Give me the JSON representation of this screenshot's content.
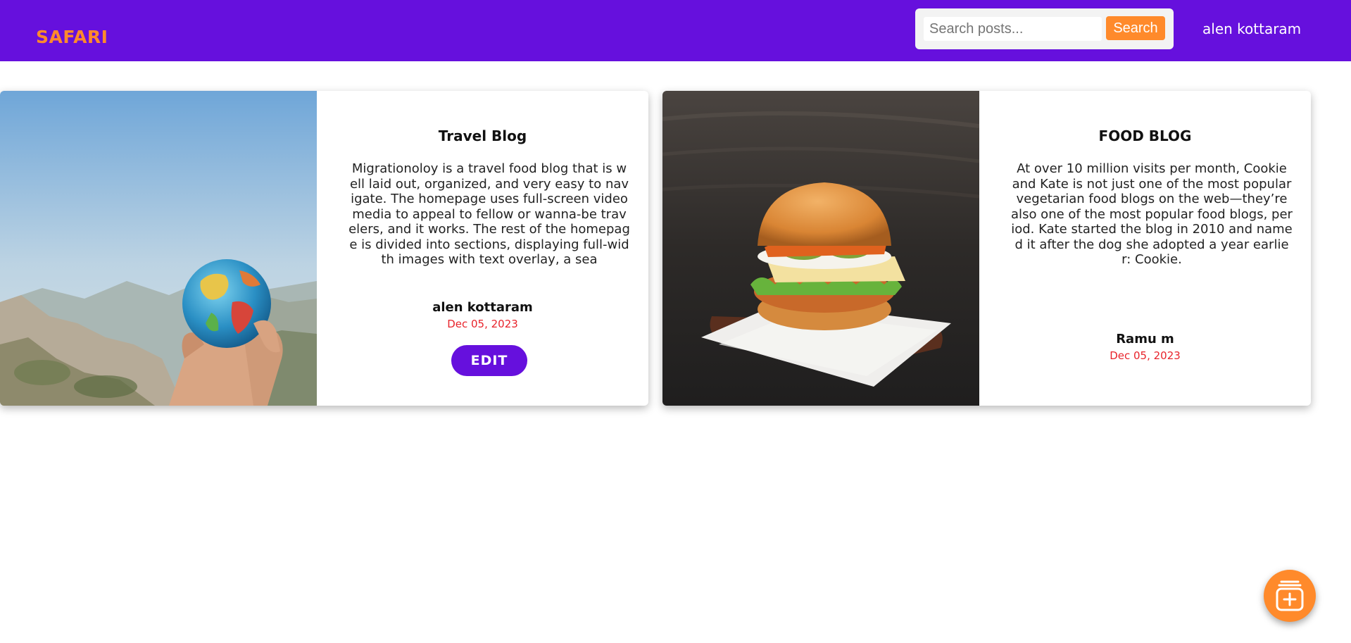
{
  "navbar": {
    "brand": "SAFARI",
    "search": {
      "placeholder": "Search posts...",
      "button_label": "Search"
    },
    "user_name": "alen kottaram"
  },
  "posts": [
    {
      "title": "Travel Blog",
      "text": "Migrationoloy is a travel food blog that is well laid out, organized, and very easy to navigate. The homepage uses full-screen video media to appeal to fellow or wanna-be travelers, and it works. The rest of the homepage is divided into sections, displaying full-width images with text overlay, a sea",
      "author": "alen kottaram",
      "date": "Dec 05, 2023",
      "edit_label": "EDIT",
      "image": "globe-in-hand-photo"
    },
    {
      "title": "FOOD BLOG",
      "text": "At over 10 million visits per month, Cookie and Kate is not just one of the most popular vegetarian food blogs on the web—they’re also one of the most popular food blogs, period. Kate started the blog in 2010 and named it after the dog she adopted a year earlier: Cookie.",
      "author": "Ramu m",
      "date": "Dec 05, 2023",
      "image": "burger-photo"
    }
  ],
  "fab": {
    "icon": "add-post-icon"
  },
  "colors": {
    "navbar": "#6610dd",
    "accent": "#ff8a2b",
    "date": "#e8232b"
  }
}
